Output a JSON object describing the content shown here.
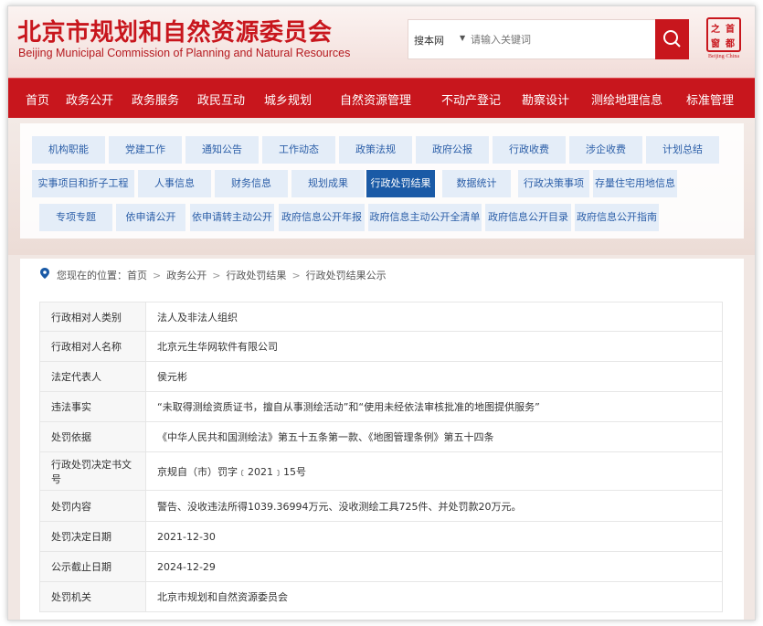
{
  "header": {
    "title_cn": "北京市规划和自然资源委员会",
    "title_en": "Beijing Municipal Commission of Planning and Natural Resources",
    "seal_chars": [
      "首",
      "都",
      "之",
      "窗"
    ],
    "seal_caption": "Beijing·China"
  },
  "search": {
    "scope": "搜本网",
    "placeholder": "请输入关键词"
  },
  "nav": {
    "items": [
      "首页",
      "政务公开",
      "政务服务",
      "政民互动",
      "城乡规划",
      "自然资源管理",
      "不动产登记",
      "勘察设计",
      "测绘地理信息",
      "标准管理"
    ]
  },
  "subnav": {
    "rows": [
      [
        "机构职能",
        "党建工作",
        "通知公告",
        "工作动态",
        "政策法规",
        "政府公报",
        "行政收费",
        "涉企收费",
        "计划总结"
      ],
      [
        "实事项目和折子工程",
        "人事信息",
        "财务信息",
        "规划成果",
        "行政处罚结果",
        "数据统计",
        "行政决策事项",
        "存量住宅用地信息"
      ],
      [
        "专项专题",
        "依申请公开",
        "依申请转主动公开",
        "政府信息公开年报",
        "政府信息主动公开全清单",
        "政府信息公开目录",
        "政府信息公开指南"
      ]
    ],
    "active": "行政处罚结果"
  },
  "breadcrumb": {
    "prefix": "您现在的位置：",
    "items": [
      "首页",
      "政务公开",
      "行政处罚结果",
      "行政处罚结果公示"
    ]
  },
  "record": {
    "rows": [
      {
        "label": "行政相对人类别",
        "value": "法人及非法人组织"
      },
      {
        "label": "行政相对人名称",
        "value": "北京元生华网软件有限公司"
      },
      {
        "label": "法定代表人",
        "value": "侯元彬"
      },
      {
        "label": "违法事实",
        "value": "“未取得测绘资质证书，擅自从事测绘活动”和“使用未经依法审核批准的地图提供服务”"
      },
      {
        "label": "处罚依据",
        "value": "《中华人民共和国测绘法》第五十五条第一款、《地图管理条例》第五十四条"
      },
      {
        "label": "行政处罚决定书文号",
        "value": "京规自（市）罚字﹝2021﹞15号"
      },
      {
        "label": "处罚内容",
        "value": "警告、没收违法所得1039.36994万元、没收测绘工具725件、并处罚款20万元。"
      },
      {
        "label": "处罚决定日期",
        "value": "2021-12-30"
      },
      {
        "label": "公示截止日期",
        "value": "2024-12-29"
      },
      {
        "label": "处罚机关",
        "value": "北京市规划和自然资源委员会"
      }
    ]
  },
  "colors": {
    "brand_red": "#c8161d",
    "chip_bg": "#e4edf8",
    "chip_text": "#2c5fa8",
    "chip_active": "#1a5aa6"
  }
}
